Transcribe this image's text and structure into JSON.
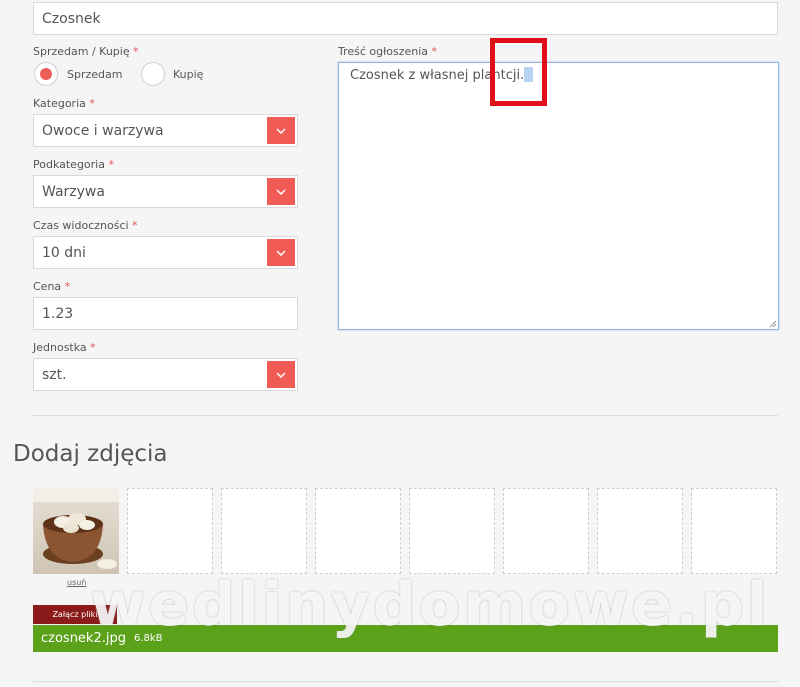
{
  "title_field": {
    "value": "Czosnek"
  },
  "trade_type": {
    "label": "Sprzedam / Kupię",
    "required_mark": "*",
    "options": [
      {
        "label": "Sprzedam",
        "selected": true
      },
      {
        "label": "Kupię",
        "selected": false
      }
    ]
  },
  "category": {
    "label": "Kategoria",
    "required_mark": "*",
    "value": "Owoce i warzywa"
  },
  "subcategory": {
    "label": "Podkategoria",
    "required_mark": "*",
    "value": "Warzywa"
  },
  "visibility": {
    "label": "Czas widoczności",
    "required_mark": "*",
    "value": "10 dni"
  },
  "price": {
    "label": "Cena",
    "required_mark": "*",
    "value": "1.23"
  },
  "unit": {
    "label": "Jednostka",
    "required_mark": "*",
    "value": "szt."
  },
  "description": {
    "label": "Treść ogłoszenia",
    "required_mark": "*",
    "value": "Czosnek z własnej plantacji.",
    "value_before": "Czosnek z własnej plant",
    "value_after": "cji."
  },
  "photos": {
    "heading": "Dodaj zdjęcia",
    "remove_label": "usuń",
    "attach_button": "Załącz pliki",
    "uploaded_file": {
      "name": "czosnek2.jpg",
      "size": "6.8kB"
    }
  },
  "watermark": "wedlinydomowe.pl",
  "colors": {
    "accent_red": "#f15b55",
    "upload_green": "#5ba119",
    "attach_button": "#8b1a1a",
    "highlight_box": "#e0101a"
  }
}
